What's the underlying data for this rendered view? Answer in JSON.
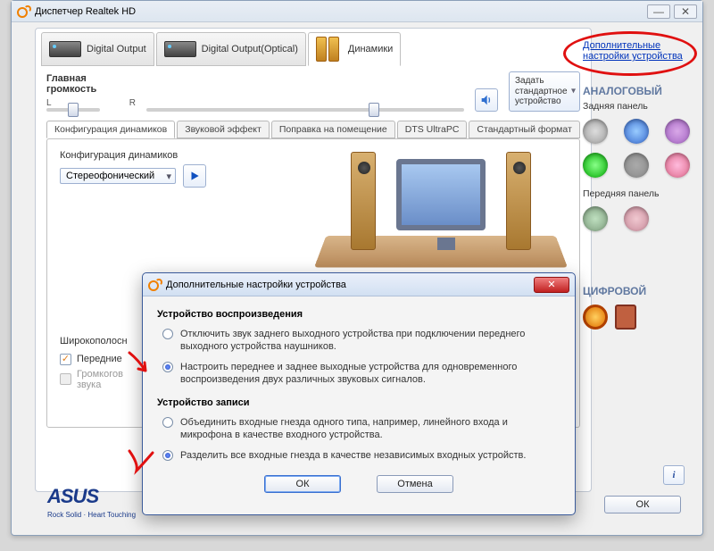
{
  "window": {
    "title": "Диспетчер Realtek HD"
  },
  "device_tabs": {
    "digital_output": "Digital Output",
    "digital_output_optical": "Digital Output(Optical)",
    "speakers": "Динамики"
  },
  "master": {
    "title": "Главная громкость",
    "left": "L",
    "right": "R",
    "default_device": "Задать\nстандартное\nустройство"
  },
  "sub_tabs": {
    "config": "Конфигурация динамиков",
    "sfx": "Звуковой эффект",
    "room": "Поправка на помещение",
    "dts": "DTS UltraPC",
    "format": "Стандартный формат"
  },
  "config": {
    "label": "Конфигурация динамиков",
    "mode": "Стереофонический",
    "wideband_label": "Широкополосн",
    "chk_front": "Передние",
    "chk_subwoofer": "Громкогов\nзвука"
  },
  "right": {
    "advanced_link": "Дополнительные настройки устройства",
    "analog_title": "АНАЛОГОВЫЙ",
    "rear_panel": "Задняя панель",
    "front_panel": "Передняя панель",
    "digital_title": "ЦИФРОВОЙ"
  },
  "dialog": {
    "title": "Дополнительные настройки устройства",
    "playback_title": "Устройство воспроизведения",
    "playback_opt1": "Отключить звук заднего выходного устройства при подключении переднего выходного устройства наушников.",
    "playback_opt2": "Настроить переднее и заднее выходные устройства для одновременного воспроизведения двух различных звуковых сигналов.",
    "record_title": "Устройство записи",
    "record_opt1": "Объединить входные гнезда одного типа, например, линейного входа и микрофона в качестве входного устройства.",
    "record_opt2": "Разделить все входные гнезда в качестве независимых входных устройств.",
    "ok": "ОК",
    "cancel": "Отмена"
  },
  "footer": {
    "asus": "ASUS",
    "asus_tag": "Rock Solid · Heart Touching",
    "info": "i",
    "ok": "ОК"
  }
}
